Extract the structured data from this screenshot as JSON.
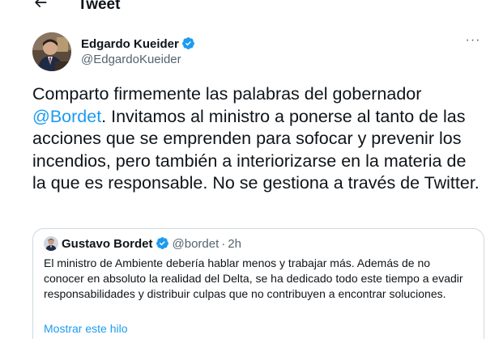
{
  "header": {
    "back_icon": "arrow-left-icon",
    "title": "Tweet"
  },
  "author": {
    "name": "Edgardo Kueider",
    "handle": "@EdgardoKueider",
    "verified": true,
    "more_icon": "ellipsis-icon",
    "more_label": "···"
  },
  "tweet": {
    "text_before": "Comparto firmemente las palabras del gobernador ",
    "mention": "@Bordet",
    "text_after": ". Invitamos al ministro a ponerse al tanto de las acciones que se emprenden para sofocar y prevenir los incendios, pero también a interiorizarse en la materia de la que es responsable. No se gestiona a través de Twitter."
  },
  "quote": {
    "name": "Gustavo Bordet",
    "handle": "@bordet",
    "separator": "·",
    "time": "2h",
    "verified": true,
    "text": "El ministro de Ambiente debería hablar menos y trabajar más. Además de no conocer en absoluto la realidad del Delta, se ha dedicado todo este tiempo a evadir responsabilidades y distribuir culpas que no contribuyen a encontrar soluciones.",
    "show_thread": "Mostrar este hilo"
  },
  "colors": {
    "accent": "#1d9bf0",
    "text": "#0f1419",
    "secondary": "#536471",
    "border": "#cfd9de"
  }
}
